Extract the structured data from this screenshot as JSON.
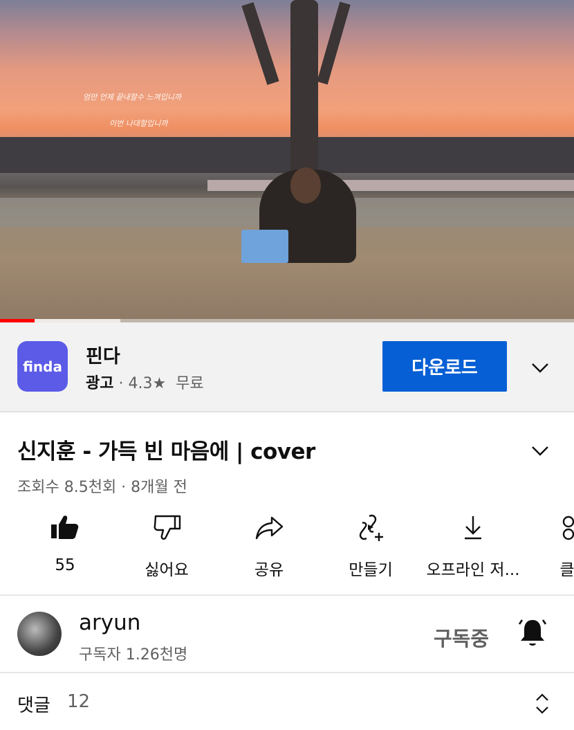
{
  "video": {
    "lyric_line1": "엄만 언제 끝내할수 느껴입니까",
    "lyric_line2": "이번 나대할입니까",
    "progress_played": 0.06,
    "progress_buffered": 0.21
  },
  "ad": {
    "logo_text": "finda",
    "name": "핀다",
    "label": "광고",
    "separator": " · ",
    "rating": "4.3★",
    "price": "무료",
    "download_label": "다운로드",
    "brand_color": "#5b5be8",
    "button_color": "#065fd4"
  },
  "video_info": {
    "title": "신지훈 - 가득 빈 마음에 | cover",
    "views_line": "조회수 8.5천회 · 8개월 전"
  },
  "actions": [
    {
      "label": "55",
      "icon": "thumbs-up-filled-icon"
    },
    {
      "label": "싫어요",
      "icon": "thumbs-down-icon"
    },
    {
      "label": "공유",
      "icon": "share-icon"
    },
    {
      "label": "만들기",
      "icon": "remix-create-icon"
    },
    {
      "label": "오프라인 저...",
      "icon": "download-icon"
    },
    {
      "label": "클",
      "icon": "clip-icon"
    }
  ],
  "channel": {
    "name": "aryun",
    "subscribers": "구독자 1.26천명",
    "subscribed_label": "구독중"
  },
  "comments": {
    "label": "댓글",
    "count": "12"
  }
}
